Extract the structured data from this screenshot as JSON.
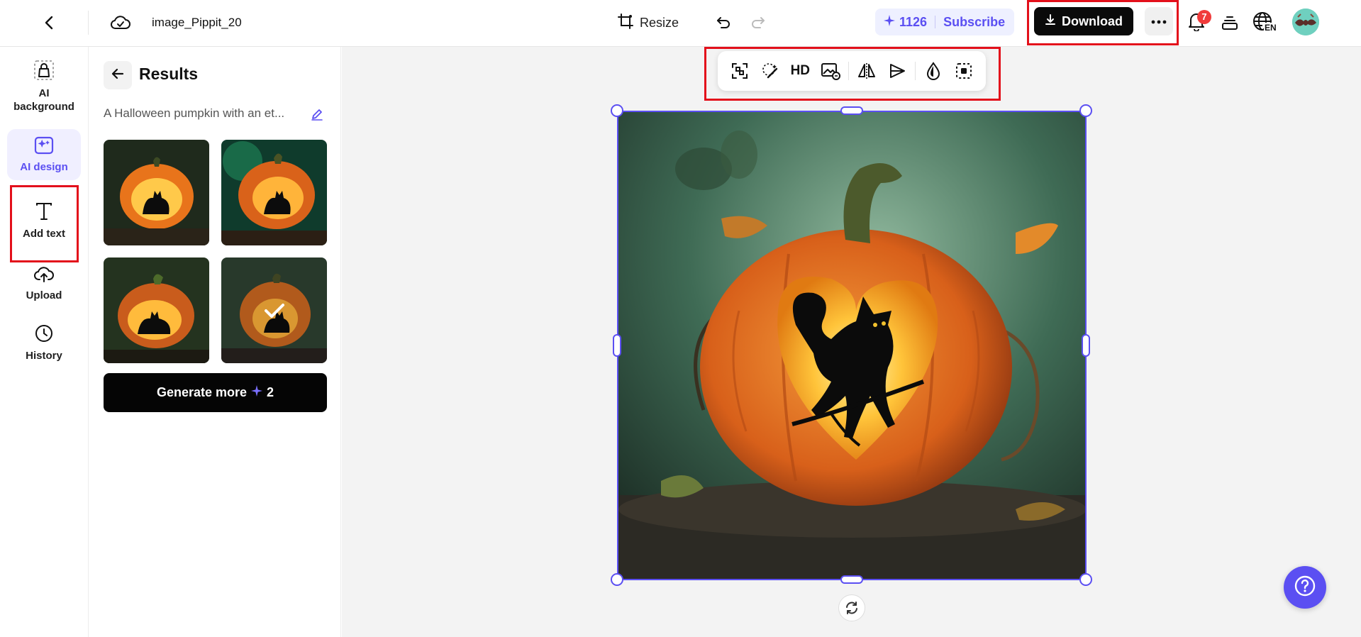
{
  "topbar": {
    "file_name": "image_Pippit_20",
    "resize_label": "Resize",
    "credits": "1126",
    "subscribe_label": "Subscribe",
    "download_label": "Download",
    "notification_count": "7",
    "language": "EN"
  },
  "rail": {
    "items": [
      {
        "label": "AI background",
        "icon": "bag-icon"
      },
      {
        "label": "AI design",
        "icon": "ai-design-icon"
      },
      {
        "label": "Add text",
        "icon": "text-icon"
      },
      {
        "label": "Upload",
        "icon": "cloud-upload-icon"
      },
      {
        "label": "History",
        "icon": "clock-icon"
      }
    ],
    "active": "AI design"
  },
  "panel": {
    "title": "Results",
    "prompt": "A Halloween pumpkin with an et...",
    "thumbnails": [
      {
        "selected": false
      },
      {
        "selected": false
      },
      {
        "selected": false
      },
      {
        "selected": true
      }
    ],
    "generate_label": "Generate more",
    "generate_cost": "2"
  },
  "toolbar": {
    "hd_label": "HD",
    "tools": [
      "cutout-icon",
      "magic-eraser-icon",
      "hd-icon",
      "image-replace-icon",
      "flip-icon",
      "send-icon",
      "opacity-icon",
      "focus-icon"
    ]
  },
  "colors": {
    "accent": "#5b4ff2",
    "highlight_box": "#e3101b",
    "download_bg": "#0a0a0a"
  }
}
